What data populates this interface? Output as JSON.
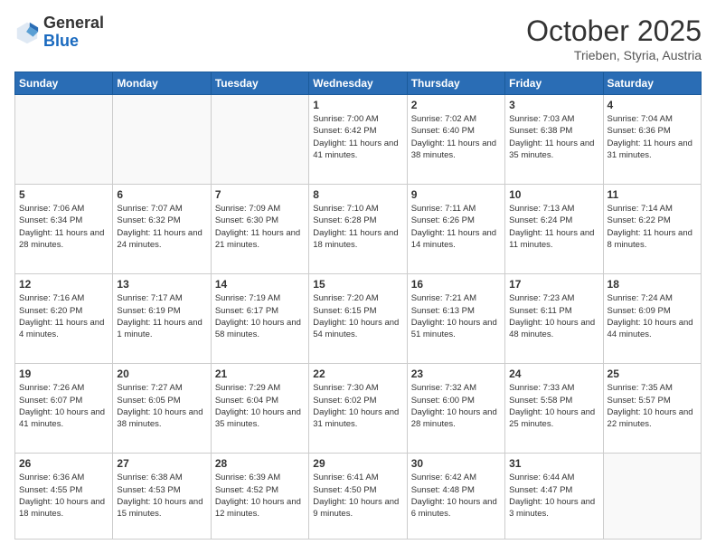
{
  "header": {
    "logo_general": "General",
    "logo_blue": "Blue",
    "month": "October 2025",
    "location": "Trieben, Styria, Austria"
  },
  "days_of_week": [
    "Sunday",
    "Monday",
    "Tuesday",
    "Wednesday",
    "Thursday",
    "Friday",
    "Saturday"
  ],
  "weeks": [
    [
      {
        "day": "",
        "info": ""
      },
      {
        "day": "",
        "info": ""
      },
      {
        "day": "",
        "info": ""
      },
      {
        "day": "1",
        "info": "Sunrise: 7:00 AM\nSunset: 6:42 PM\nDaylight: 11 hours and 41 minutes."
      },
      {
        "day": "2",
        "info": "Sunrise: 7:02 AM\nSunset: 6:40 PM\nDaylight: 11 hours and 38 minutes."
      },
      {
        "day": "3",
        "info": "Sunrise: 7:03 AM\nSunset: 6:38 PM\nDaylight: 11 hours and 35 minutes."
      },
      {
        "day": "4",
        "info": "Sunrise: 7:04 AM\nSunset: 6:36 PM\nDaylight: 11 hours and 31 minutes."
      }
    ],
    [
      {
        "day": "5",
        "info": "Sunrise: 7:06 AM\nSunset: 6:34 PM\nDaylight: 11 hours and 28 minutes."
      },
      {
        "day": "6",
        "info": "Sunrise: 7:07 AM\nSunset: 6:32 PM\nDaylight: 11 hours and 24 minutes."
      },
      {
        "day": "7",
        "info": "Sunrise: 7:09 AM\nSunset: 6:30 PM\nDaylight: 11 hours and 21 minutes."
      },
      {
        "day": "8",
        "info": "Sunrise: 7:10 AM\nSunset: 6:28 PM\nDaylight: 11 hours and 18 minutes."
      },
      {
        "day": "9",
        "info": "Sunrise: 7:11 AM\nSunset: 6:26 PM\nDaylight: 11 hours and 14 minutes."
      },
      {
        "day": "10",
        "info": "Sunrise: 7:13 AM\nSunset: 6:24 PM\nDaylight: 11 hours and 11 minutes."
      },
      {
        "day": "11",
        "info": "Sunrise: 7:14 AM\nSunset: 6:22 PM\nDaylight: 11 hours and 8 minutes."
      }
    ],
    [
      {
        "day": "12",
        "info": "Sunrise: 7:16 AM\nSunset: 6:20 PM\nDaylight: 11 hours and 4 minutes."
      },
      {
        "day": "13",
        "info": "Sunrise: 7:17 AM\nSunset: 6:19 PM\nDaylight: 11 hours and 1 minute."
      },
      {
        "day": "14",
        "info": "Sunrise: 7:19 AM\nSunset: 6:17 PM\nDaylight: 10 hours and 58 minutes."
      },
      {
        "day": "15",
        "info": "Sunrise: 7:20 AM\nSunset: 6:15 PM\nDaylight: 10 hours and 54 minutes."
      },
      {
        "day": "16",
        "info": "Sunrise: 7:21 AM\nSunset: 6:13 PM\nDaylight: 10 hours and 51 minutes."
      },
      {
        "day": "17",
        "info": "Sunrise: 7:23 AM\nSunset: 6:11 PM\nDaylight: 10 hours and 48 minutes."
      },
      {
        "day": "18",
        "info": "Sunrise: 7:24 AM\nSunset: 6:09 PM\nDaylight: 10 hours and 44 minutes."
      }
    ],
    [
      {
        "day": "19",
        "info": "Sunrise: 7:26 AM\nSunset: 6:07 PM\nDaylight: 10 hours and 41 minutes."
      },
      {
        "day": "20",
        "info": "Sunrise: 7:27 AM\nSunset: 6:05 PM\nDaylight: 10 hours and 38 minutes."
      },
      {
        "day": "21",
        "info": "Sunrise: 7:29 AM\nSunset: 6:04 PM\nDaylight: 10 hours and 35 minutes."
      },
      {
        "day": "22",
        "info": "Sunrise: 7:30 AM\nSunset: 6:02 PM\nDaylight: 10 hours and 31 minutes."
      },
      {
        "day": "23",
        "info": "Sunrise: 7:32 AM\nSunset: 6:00 PM\nDaylight: 10 hours and 28 minutes."
      },
      {
        "day": "24",
        "info": "Sunrise: 7:33 AM\nSunset: 5:58 PM\nDaylight: 10 hours and 25 minutes."
      },
      {
        "day": "25",
        "info": "Sunrise: 7:35 AM\nSunset: 5:57 PM\nDaylight: 10 hours and 22 minutes."
      }
    ],
    [
      {
        "day": "26",
        "info": "Sunrise: 6:36 AM\nSunset: 4:55 PM\nDaylight: 10 hours and 18 minutes."
      },
      {
        "day": "27",
        "info": "Sunrise: 6:38 AM\nSunset: 4:53 PM\nDaylight: 10 hours and 15 minutes."
      },
      {
        "day": "28",
        "info": "Sunrise: 6:39 AM\nSunset: 4:52 PM\nDaylight: 10 hours and 12 minutes."
      },
      {
        "day": "29",
        "info": "Sunrise: 6:41 AM\nSunset: 4:50 PM\nDaylight: 10 hours and 9 minutes."
      },
      {
        "day": "30",
        "info": "Sunrise: 6:42 AM\nSunset: 4:48 PM\nDaylight: 10 hours and 6 minutes."
      },
      {
        "day": "31",
        "info": "Sunrise: 6:44 AM\nSunset: 4:47 PM\nDaylight: 10 hours and 3 minutes."
      },
      {
        "day": "",
        "info": ""
      }
    ]
  ]
}
